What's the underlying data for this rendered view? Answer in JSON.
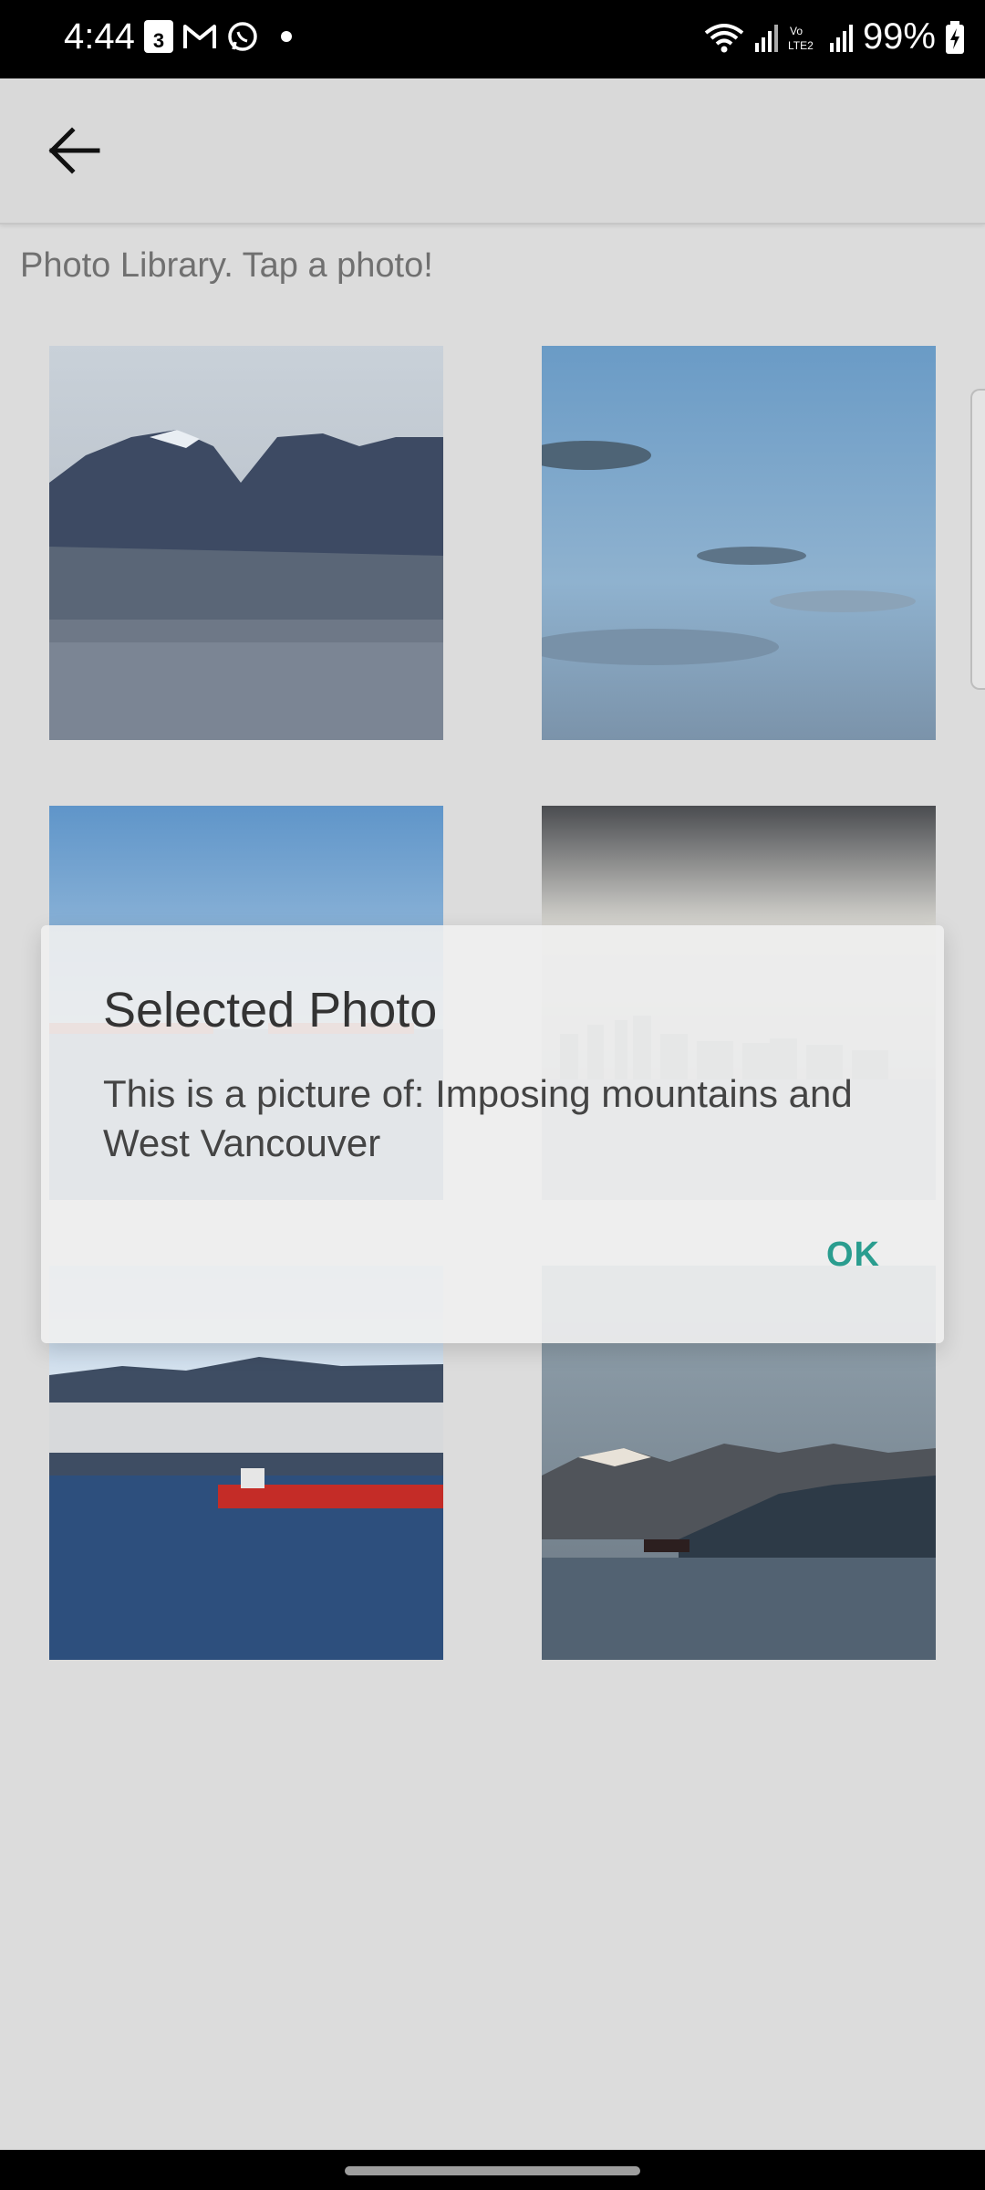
{
  "status_bar": {
    "time": "4:44",
    "calendar_badge": "3",
    "battery": "99%",
    "icons": [
      "calendar-icon",
      "gmail-icon",
      "whatsapp-icon",
      "notification-dot",
      "wifi-icon",
      "signal-icon",
      "volte-icon",
      "signal-icon",
      "battery-charging-icon"
    ]
  },
  "app_bar": {
    "back_icon": "arrow-left-icon"
  },
  "header": {
    "subtitle": "Photo Library. Tap a photo!"
  },
  "photos": [
    {
      "label": "mountains-and-west-vancouver"
    },
    {
      "label": "sky-clouds"
    },
    {
      "label": "ships-on-water"
    },
    {
      "label": "city-skyline-fog"
    },
    {
      "label": "red-tanker-mountains"
    },
    {
      "label": "mountains-dusk-ship"
    }
  ],
  "dialog": {
    "title": "Selected Photo",
    "message": "This is a picture of: Imposing mountains and West Vancouver",
    "ok_label": "OK"
  },
  "colors": {
    "accent": "#2a9d8f",
    "statusbar": "#000000",
    "background": "#dcdcdc"
  }
}
